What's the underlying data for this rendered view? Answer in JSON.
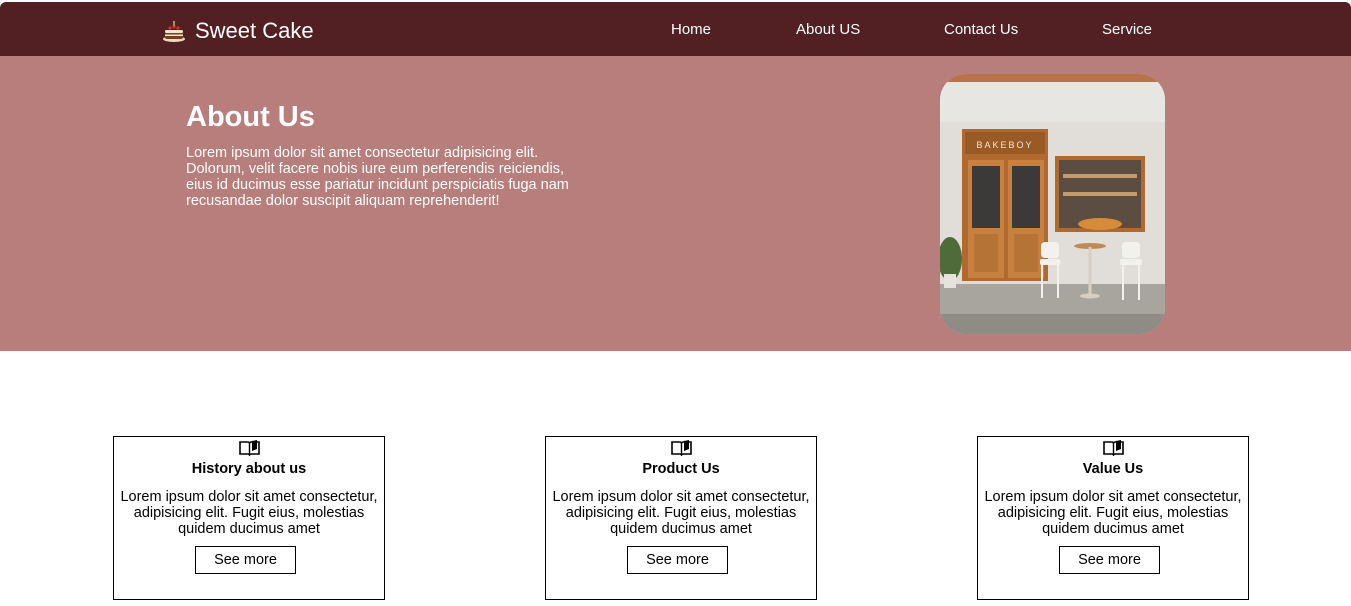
{
  "colors": {
    "nav_bg": "#522023",
    "hero_bg": "#b77e7b",
    "text_light": "#ffffff",
    "card_border": "#000000"
  },
  "brand": {
    "name": "Sweet Cake",
    "icon": "cake-icon"
  },
  "nav": {
    "items": [
      {
        "label": "Home"
      },
      {
        "label": "About US"
      },
      {
        "label": "Contact Us"
      },
      {
        "label": "Service"
      }
    ]
  },
  "hero": {
    "title": "About Us",
    "text": "Lorem ipsum dolor sit amet consectetur adipisicing elit. Dolorum, velit facere nobis iure eum perferendis reiciendis, eius id ducimus esse pariatur incidunt perspiciatis fuga nam recusandae dolor suscipit aliquam reprehenderit!",
    "image": {
      "description": "bakery storefront photo",
      "sign_text": "BAKEBOY"
    }
  },
  "cards": [
    {
      "icon": "book-icon",
      "title": "History about us",
      "text": "Lorem ipsum dolor sit amet consectetur, adipisicing elit. Fugit eius, molestias quidem ducimus amet",
      "button": "See more"
    },
    {
      "icon": "book-icon",
      "title": "Product Us",
      "text": "Lorem ipsum dolor sit amet consectetur, adipisicing elit. Fugit eius, molestias quidem ducimus amet",
      "button": "See more"
    },
    {
      "icon": "book-icon",
      "title": "Value Us",
      "text": "Lorem ipsum dolor sit amet consectetur, adipisicing elit. Fugit eius, molestias quidem ducimus amet",
      "button": "See more"
    }
  ]
}
